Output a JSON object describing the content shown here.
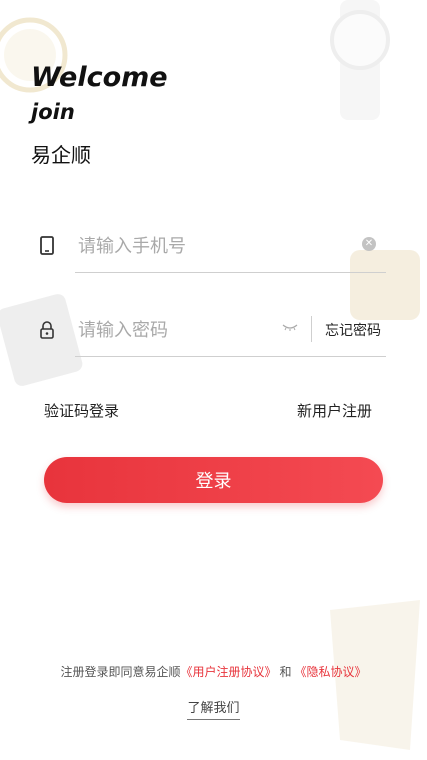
{
  "header": {
    "welcome": "Welcome",
    "join": "join",
    "brand": "易企顺"
  },
  "form": {
    "phone": {
      "placeholder": "请输入手机号",
      "value": "",
      "icon": "phone-icon",
      "clear_icon": "clear-icon"
    },
    "password": {
      "placeholder": "请输入密码",
      "value": "",
      "icon": "lock-icon",
      "toggle_icon": "eye-closed-icon",
      "forgot_label": "忘记密码"
    }
  },
  "links": {
    "sms_login": "验证码登录",
    "register": "新用户注册"
  },
  "login_button": "登录",
  "footer": {
    "prefix": "注册登录即同意易企顺",
    "user_agreement": "《用户注册协议》",
    "and": "和",
    "privacy_policy": "《隐私协议》",
    "about_us": "了解我们"
  },
  "colors": {
    "accent": "#e8343c",
    "text": "#222222",
    "placeholder": "#a9a9a9",
    "divider": "#cfcfcf"
  }
}
